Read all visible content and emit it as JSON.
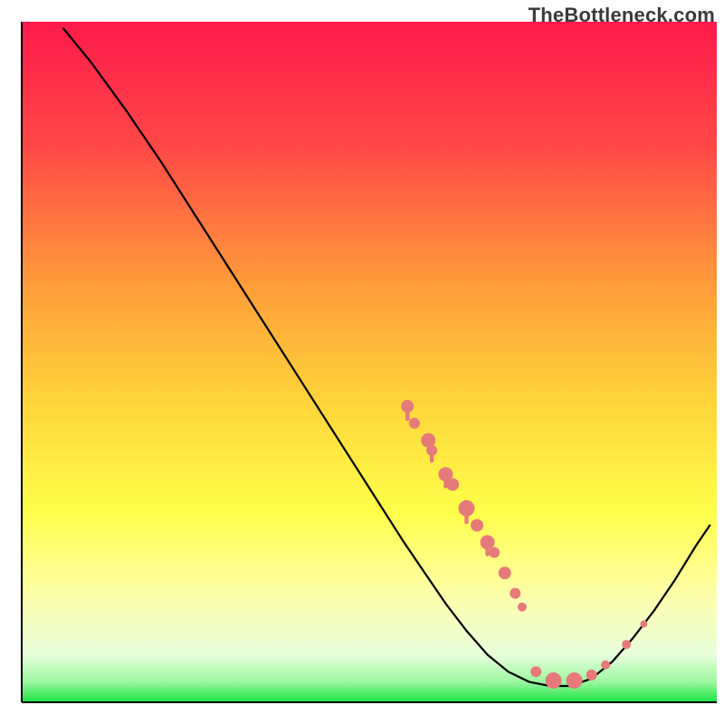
{
  "watermark": "TheBottleneck.com",
  "chart_data": {
    "type": "line",
    "title": "",
    "xlabel": "",
    "ylabel": "",
    "xlim": [
      0,
      100
    ],
    "ylim": [
      0,
      100
    ],
    "grid": false,
    "legend": false,
    "background_gradient": {
      "stops": [
        {
          "offset": 0.0,
          "color": "#ff1a4b"
        },
        {
          "offset": 0.18,
          "color": "#ff4747"
        },
        {
          "offset": 0.38,
          "color": "#ff9a3b"
        },
        {
          "offset": 0.55,
          "color": "#ffd23a"
        },
        {
          "offset": 0.72,
          "color": "#ffff4a"
        },
        {
          "offset": 0.85,
          "color": "#fdffb0"
        },
        {
          "offset": 0.93,
          "color": "#e8ffdc"
        },
        {
          "offset": 0.97,
          "color": "#9cf7a0"
        },
        {
          "offset": 1.0,
          "color": "#19e342"
        }
      ]
    },
    "series": [
      {
        "name": "bottleneck-curve",
        "color": "#000000",
        "points": [
          {
            "x": 6.0,
            "y": 99.0
          },
          {
            "x": 10.0,
            "y": 94.0
          },
          {
            "x": 15.0,
            "y": 87.0
          },
          {
            "x": 20.0,
            "y": 79.5
          },
          {
            "x": 25.0,
            "y": 71.5
          },
          {
            "x": 30.0,
            "y": 63.5
          },
          {
            "x": 35.0,
            "y": 55.5
          },
          {
            "x": 40.0,
            "y": 47.5
          },
          {
            "x": 45.0,
            "y": 39.5
          },
          {
            "x": 50.0,
            "y": 31.5
          },
          {
            "x": 55.0,
            "y": 23.5
          },
          {
            "x": 58.0,
            "y": 19.0
          },
          {
            "x": 61.0,
            "y": 14.5
          },
          {
            "x": 64.0,
            "y": 10.5
          },
          {
            "x": 67.0,
            "y": 7.0
          },
          {
            "x": 70.0,
            "y": 4.5
          },
          {
            "x": 73.0,
            "y": 3.0
          },
          {
            "x": 76.0,
            "y": 2.4
          },
          {
            "x": 79.0,
            "y": 2.4
          },
          {
            "x": 82.0,
            "y": 3.5
          },
          {
            "x": 85.0,
            "y": 6.0
          },
          {
            "x": 88.0,
            "y": 9.5
          },
          {
            "x": 91.0,
            "y": 13.5
          },
          {
            "x": 94.0,
            "y": 18.0
          },
          {
            "x": 97.0,
            "y": 23.0
          },
          {
            "x": 99.0,
            "y": 26.0
          }
        ]
      }
    ],
    "markers": {
      "name": "highlighted-points",
      "color": "#e67a7a",
      "points": [
        {
          "x": 55.5,
          "y": 43.5,
          "r": 7,
          "drip": 15
        },
        {
          "x": 56.5,
          "y": 41.0,
          "r": 6,
          "drip": 0
        },
        {
          "x": 58.5,
          "y": 38.5,
          "r": 8,
          "drip": 0
        },
        {
          "x": 59.0,
          "y": 37.0,
          "r": 6,
          "drip": 12
        },
        {
          "x": 61.0,
          "y": 33.5,
          "r": 8,
          "drip": 14
        },
        {
          "x": 62.0,
          "y": 32.0,
          "r": 7,
          "drip": 0
        },
        {
          "x": 64.0,
          "y": 28.5,
          "r": 9,
          "drip": 16
        },
        {
          "x": 65.5,
          "y": 26.0,
          "r": 7,
          "drip": 0
        },
        {
          "x": 67.0,
          "y": 23.5,
          "r": 8,
          "drip": 14
        },
        {
          "x": 68.0,
          "y": 22.0,
          "r": 6,
          "drip": 0
        },
        {
          "x": 69.5,
          "y": 19.0,
          "r": 7,
          "drip": 0
        },
        {
          "x": 71.0,
          "y": 16.0,
          "r": 6,
          "drip": 0
        },
        {
          "x": 72.0,
          "y": 14.0,
          "r": 5,
          "drip": 0
        },
        {
          "x": 74.0,
          "y": 4.5,
          "r": 6,
          "drip": 0
        },
        {
          "x": 76.5,
          "y": 3.2,
          "r": 9,
          "drip": 0
        },
        {
          "x": 79.5,
          "y": 3.2,
          "r": 9,
          "drip": 0
        },
        {
          "x": 82.0,
          "y": 4.0,
          "r": 6,
          "drip": 0
        },
        {
          "x": 84.0,
          "y": 5.5,
          "r": 5,
          "drip": 0
        },
        {
          "x": 87.0,
          "y": 8.5,
          "r": 5,
          "drip": 0
        },
        {
          "x": 89.5,
          "y": 11.5,
          "r": 4,
          "drip": 0
        }
      ]
    }
  }
}
